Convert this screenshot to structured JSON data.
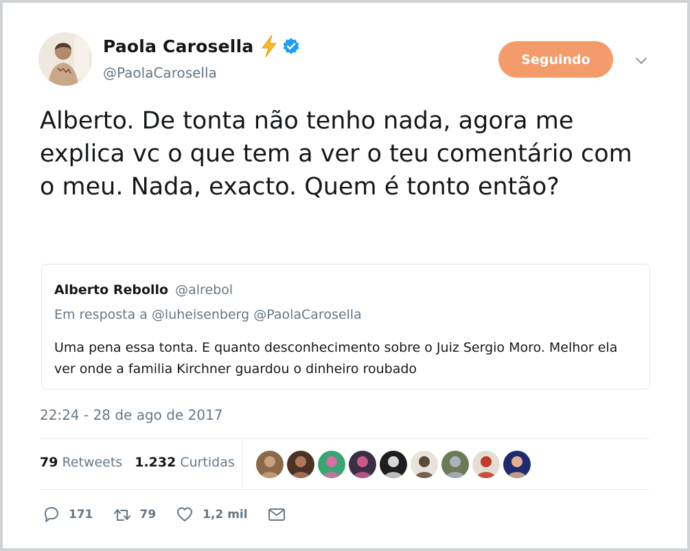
{
  "author": {
    "name": "Paola Carosella",
    "handle": "@PaolaCarosella",
    "emoji_icon": "lightning-bolt-icon",
    "verified_icon": "verified-badge-icon"
  },
  "follow_button": {
    "label": "Seguindo",
    "color": "#f49b6b"
  },
  "tweet": {
    "text": "Alberto. De tonta não tenho nada, agora me explica vc o que tem a ver o teu comentário com o meu. Nada, exacto. Quem é tonto então?"
  },
  "quoted_tweet": {
    "name": "Alberto Rebollo",
    "handle": "@alrebol",
    "reply_to": "Em resposta a @luheisenberg @PaolaCarosella",
    "text": "Uma pena essa tonta. E quanto desconhecimento sobre o Juiz Sergio Moro. Melhor ela ver onde a familia Kirchner guardou o dinheiro roubado"
  },
  "timestamp": "22:24 - 28 de ago de 2017",
  "stats": {
    "retweets_count": "79",
    "retweets_label": "Retweets",
    "likes_count": "1.232",
    "likes_label": "Curtidas"
  },
  "liker_avatars": [
    {
      "bg": "#8a6a4a",
      "fg": "#c9a27c"
    },
    {
      "bg": "#4a3325",
      "fg": "#b07a5a"
    },
    {
      "bg": "#3aa573",
      "fg": "#d36fa3"
    },
    {
      "bg": "#3a2f45",
      "fg": "#c85a8a"
    },
    {
      "bg": "#1e1e1e",
      "fg": "#d8d8d8"
    },
    {
      "bg": "#e8e3d8",
      "fg": "#5a4a3a"
    },
    {
      "bg": "#6d7a58",
      "fg": "#a8b4c0"
    },
    {
      "bg": "#e3ddd3",
      "fg": "#c0392b"
    },
    {
      "bg": "#1f2b6e",
      "fg": "#e0b090"
    }
  ],
  "actions": {
    "reply_count": "171",
    "retweet_count": "79",
    "like_count": "1,2 mil"
  },
  "colors": {
    "text": "#14171a",
    "secondary": "#657786",
    "verified": "#1da1f2",
    "bolt": "#f5b82e",
    "border": "#e1e8ed"
  }
}
